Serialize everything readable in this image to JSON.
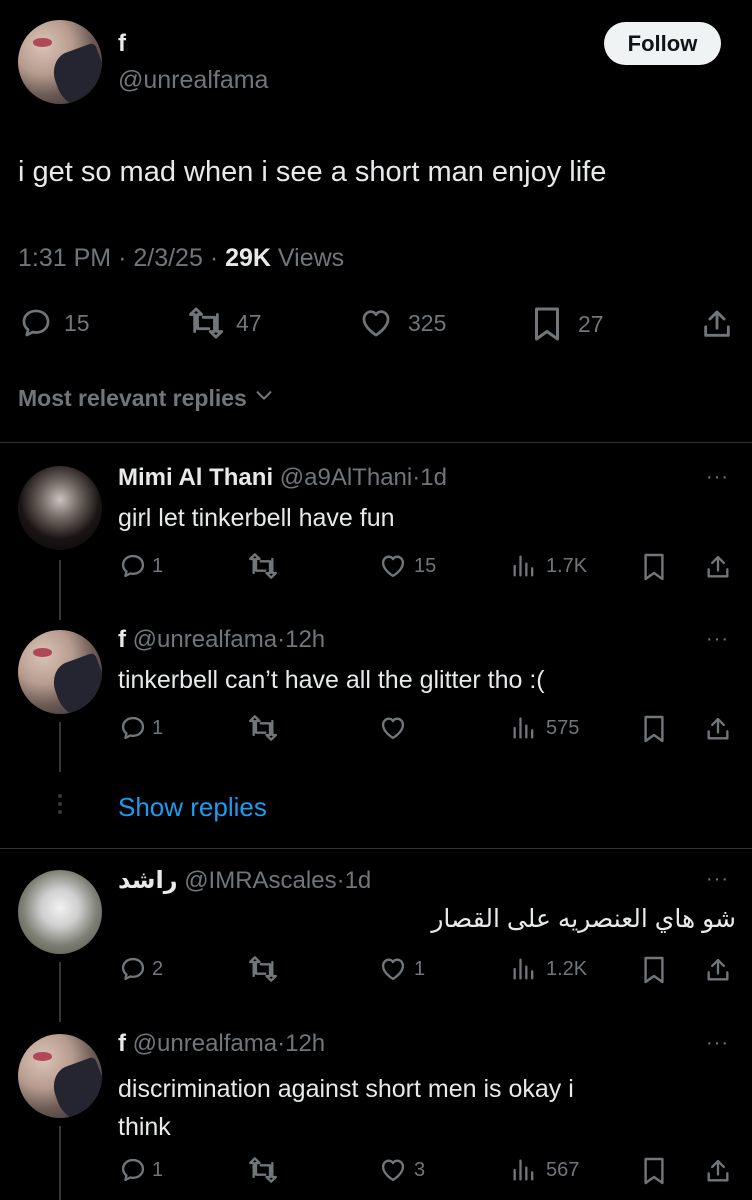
{
  "post": {
    "author_name": "f",
    "author_handle": "@unrealfama",
    "follow_label": "Follow",
    "text": "i get so mad when i see a short man enjoy life",
    "time": "1:31 PM",
    "date": "2/3/25",
    "views_count": "29K",
    "views_label": "Views",
    "replies": "15",
    "reposts": "47",
    "likes": "325",
    "bookmarks": "27"
  },
  "sort": {
    "label": "Most relevant replies"
  },
  "replies": [
    {
      "name": "Mimi Al Thani",
      "handle": "@a9AlThani",
      "age": "1d",
      "text": "girl let tinkerbell have fun",
      "replies": "1",
      "reposts": "",
      "likes": "15",
      "views": "1.7K"
    },
    {
      "name": "f",
      "handle": "@unrealfama",
      "age": "12h",
      "text": "tinkerbell can’t have all the glitter tho :(",
      "replies": "1",
      "reposts": "",
      "likes": "",
      "views": "575"
    },
    {
      "name": "راشد",
      "handle": "@IMRAscales",
      "age": "1d",
      "text": "شو هاي العنصريه على القصار",
      "replies": "2",
      "reposts": "",
      "likes": "1",
      "views": "1.2K"
    },
    {
      "name": "f",
      "handle": "@unrealfama",
      "age": "12h",
      "text_line1": "discrimination against short men is okay i",
      "text_line2": "think",
      "replies": "1",
      "reposts": "",
      "likes": "3",
      "views": "567"
    }
  ],
  "show_replies": {
    "label": "Show replies"
  },
  "separator": "·",
  "colors": {
    "background": "#000000",
    "text": "#e7e9ea",
    "muted": "#71767b",
    "link": "#1d9bf0",
    "divider": "#2f3336"
  }
}
